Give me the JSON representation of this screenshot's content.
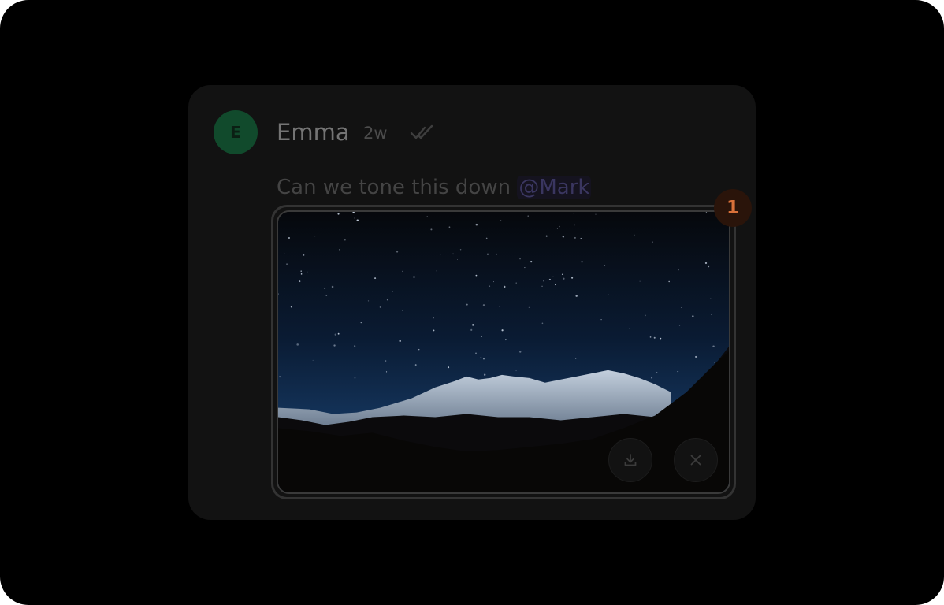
{
  "comment": {
    "avatar_initial": "E",
    "author": "Emma",
    "time": "2w",
    "read_icon": "double-check-icon",
    "message_text": "Can we tone this down ",
    "mention": "@Mark"
  },
  "attachment": {
    "count_badge": "1",
    "download_icon": "download-icon",
    "close_icon": "close-icon"
  },
  "colors": {
    "background": "#000000",
    "card": "#121212",
    "avatar": "#114a2c",
    "badge_text": "#d9713a",
    "mention": "#3a3660"
  }
}
